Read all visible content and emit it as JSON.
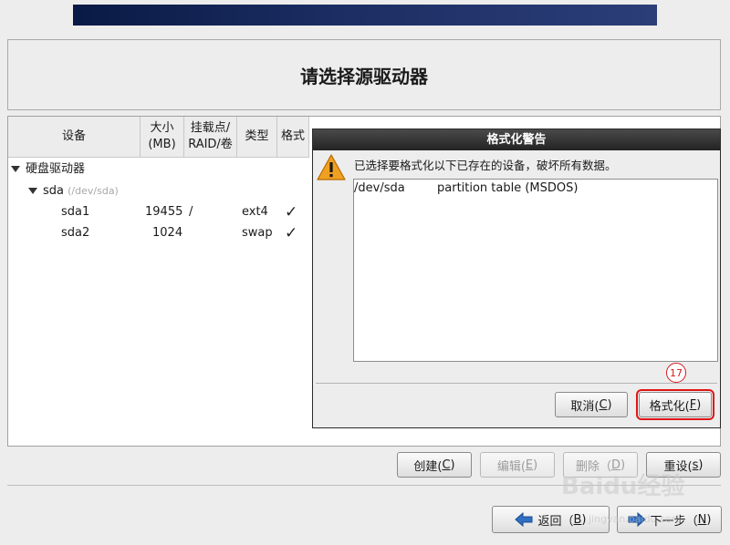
{
  "page": {
    "title": "请选择源驱动器",
    "colors": {
      "banner": "#1b2d62",
      "annotation_red": "#d21d1d"
    }
  },
  "tree": {
    "columns": [
      "设备",
      "大小\n(MB)",
      "挂载点/\nRAID/卷",
      "类型",
      "格式"
    ],
    "root_label": "硬盘驱动器",
    "disk": {
      "name": "sda",
      "path": "(/dev/sda)"
    },
    "partitions": [
      {
        "name": "sda1",
        "size": "19455",
        "mount": "/",
        "type": "ext4",
        "format": "✓"
      },
      {
        "name": "sda2",
        "size": "1024",
        "mount": "",
        "type": "swap",
        "format": "✓"
      }
    ]
  },
  "dialog": {
    "title": "格式化警告",
    "icon": "warning-icon",
    "message": "已选择要格式化以下已存在的设备，破坏所有数据。",
    "list": [
      {
        "device": "/dev/sda",
        "desc": "partition table (MSDOS)"
      }
    ],
    "annotation_number": "17",
    "cancel": {
      "label": "取消(",
      "key": "C",
      "tail": ")"
    },
    "format": {
      "label": "格式化(",
      "key": "F",
      "tail": ")"
    }
  },
  "actions": {
    "create": {
      "label": "创建(",
      "key": "C",
      "tail": ")"
    },
    "edit": {
      "label": "编辑(",
      "key": "E",
      "tail": ")"
    },
    "delete": {
      "label": "删除（",
      "key": "D",
      "tail": ")"
    },
    "reset": {
      "label": "重设(",
      "key": "s",
      "tail": ")"
    }
  },
  "nav": {
    "back": {
      "label": "返回（",
      "key": "B",
      "tail": ")",
      "icon": "arrow-left-icon"
    },
    "next": {
      "label": "下一步（",
      "key": "N",
      "tail": ")",
      "icon": "arrow-right-icon"
    }
  },
  "watermark": {
    "text": "Baidu经验",
    "sub": "jingyan.baidu.com"
  }
}
